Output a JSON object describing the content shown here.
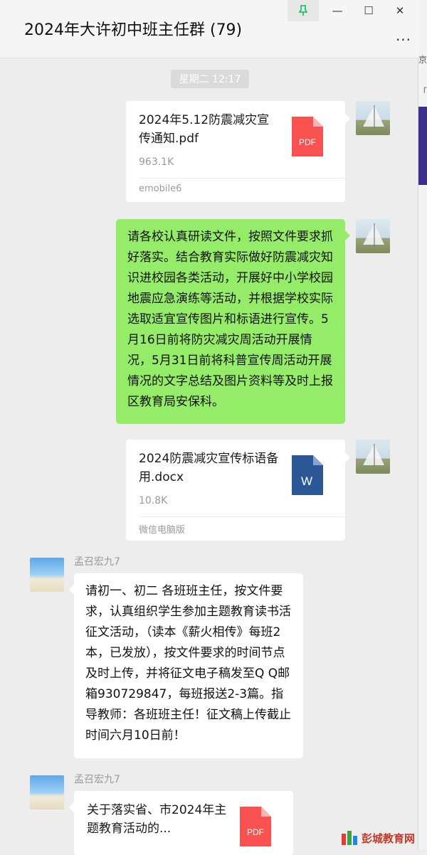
{
  "window": {
    "title": "2024年大许初中班主任群 (79)",
    "controls": {
      "pin_icon": "pin-icon",
      "minimize": "—",
      "maximize": "☐",
      "close": "✕",
      "more": "..."
    }
  },
  "right_strip": {
    "text1": "京",
    "text2": "「省"
  },
  "timestamp": "星期二 12:17",
  "messages": [
    {
      "type": "file",
      "sender": "self",
      "file_name": "2024年5.12防震减灾宣传通知.pdf",
      "file_size": "963.1K",
      "source": "emobile6",
      "icon": "pdf-file-icon",
      "icon_label": "PDF",
      "icon_color": "#fa5151"
    },
    {
      "type": "text",
      "sender": "self",
      "text": "请各校认真研读文件，按照文件要求抓好落实。结合教育实际做好防震减灾知识进校园各类活动，开展好中小学校园地震应急演练等活动，并根据学校实际选取适宜宣传图片和标语进行宣传。5 月16日前将防灾减灾周活动开展情况，5月31日前将科普宣传周活动开展情况的文字总结及图片资料等及时上报区教育局安保科。"
    },
    {
      "type": "file",
      "sender": "self",
      "file_name": "2024防震减灾宣传标语备用.docx",
      "file_size": "10.8K",
      "source": "微信电脑版",
      "icon": "word-file-icon",
      "icon_label": "W",
      "icon_color": "#2b5797"
    },
    {
      "type": "text",
      "sender": "other",
      "sender_name": "孟召宏九7",
      "text": "请初一、初二 各班班主任，按文件要求，认真组织学生参加主题教育读书活征文活动，（读本《薪火相传》每班2本，已发放），按文件要求的时间节点及时上传，并将征文电子稿发至Q Q邮箱930729847，每班报送2-3篇。指导教师：各班班主任！征文稿上传截止时间六月10日前！"
    },
    {
      "type": "file",
      "sender": "other",
      "sender_name": "孟召宏九7",
      "file_name": "关于落实省、市2024年主题教育活动的...",
      "icon": "pdf-file-icon",
      "icon_label": "PDF",
      "icon_color": "#fa5151"
    }
  ],
  "watermark": {
    "text": "彭城教育网"
  },
  "colors": {
    "self_bubble": "#95ec69",
    "other_bubble": "#ffffff",
    "background": "#ededed"
  }
}
